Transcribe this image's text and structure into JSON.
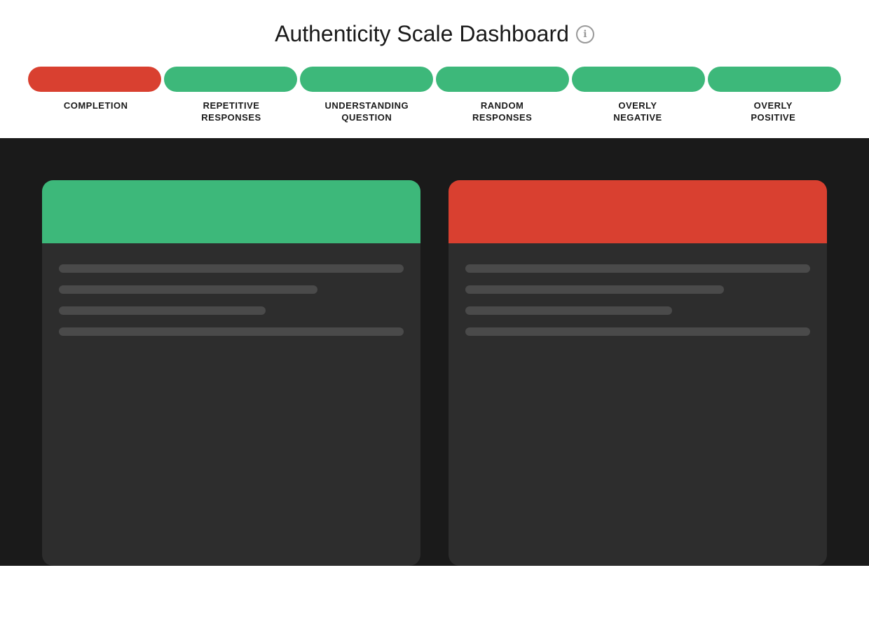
{
  "header": {
    "title": "Authenticity Scale Dashboard",
    "info_icon": "ℹ"
  },
  "scale": {
    "segments": [
      {
        "id": "completion",
        "color": "red"
      },
      {
        "id": "repetitive",
        "color": "green"
      },
      {
        "id": "understanding",
        "color": "green"
      },
      {
        "id": "random",
        "color": "green"
      },
      {
        "id": "overly-negative",
        "color": "green"
      },
      {
        "id": "overly-positive",
        "color": "green"
      }
    ],
    "labels": [
      {
        "id": "completion-label",
        "line1": "COMPLETION",
        "line2": ""
      },
      {
        "id": "repetitive-label",
        "line1": "REPETITIVE",
        "line2": "RESPONSES"
      },
      {
        "id": "understanding-label",
        "line1": "UNDERSTANDING",
        "line2": "QUESTION"
      },
      {
        "id": "random-label",
        "line1": "RANDOM",
        "line2": "RESPONSES"
      },
      {
        "id": "overly-negative-label",
        "line1": "OVERLY",
        "line2": "NEGATIVE"
      },
      {
        "id": "overly-positive-label",
        "line1": "OVERLY",
        "line2": "POSITIVE"
      }
    ]
  },
  "cards": [
    {
      "id": "card-green",
      "header_color": "green",
      "lines": [
        "full",
        "75",
        "60",
        "full"
      ]
    },
    {
      "id": "card-red",
      "header_color": "red",
      "lines": [
        "full",
        "75",
        "60",
        "full"
      ]
    }
  ],
  "colors": {
    "red": "#d94030",
    "green": "#3db87a",
    "dark_bg": "#1a1a1a",
    "card_bg": "#2d2d2d",
    "skeleton": "#4a4a4a"
  }
}
